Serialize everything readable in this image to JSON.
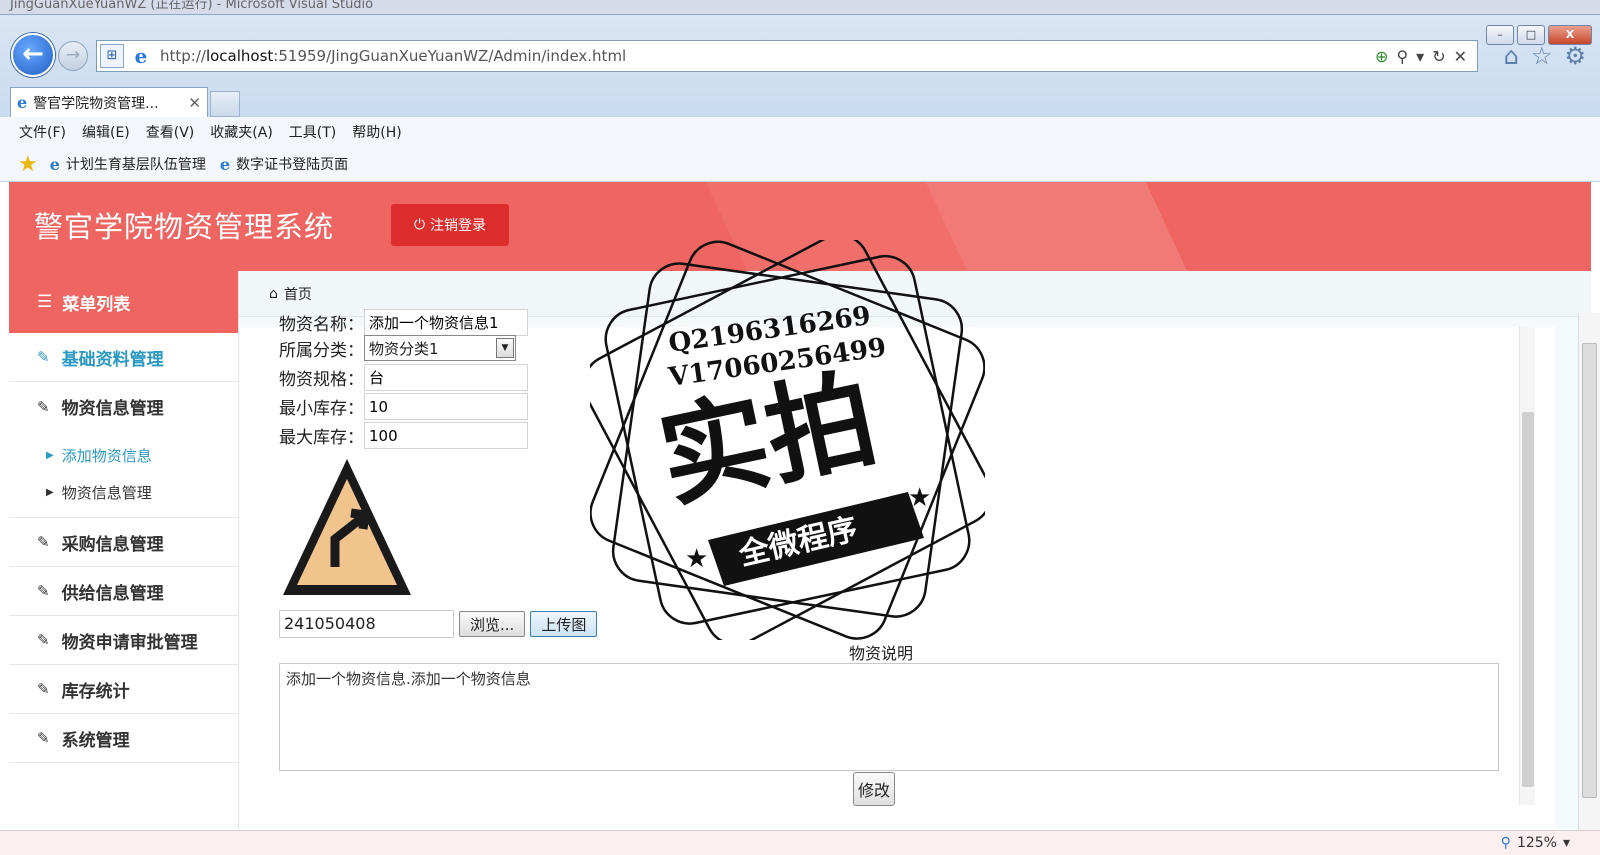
{
  "window": {
    "caption": "JingGuanXueYuanWZ (正在运行) - Microsoft Visual Studio",
    "min": "–",
    "max": "□",
    "close": "X"
  },
  "browser": {
    "url_host": "localhost",
    "url_prefix": "http://",
    "url_suffix": ":51959/JingGuanXueYuanWZ/Admin/index.html",
    "tab_title": "警官学院物资管理...",
    "menu": [
      "文件(F)",
      "编辑(E)",
      "查看(V)",
      "收藏夹(A)",
      "工具(T)",
      "帮助(H)"
    ],
    "favorites": [
      "计划生育基层队伍管理",
      "数字证书登陆页面"
    ],
    "zoom": "125%"
  },
  "header": {
    "title": "警官学院物资管理系统",
    "logout_label": "注销登录"
  },
  "sidebar": {
    "heading": "菜单列表",
    "items": [
      "基础资料管理",
      "物资信息管理",
      "采购信息管理",
      "供给信息管理",
      "物资申请审批管理",
      "库存统计",
      "系统管理"
    ],
    "sub_items": [
      "添加物资信息",
      "物资信息管理"
    ]
  },
  "breadcrumb": {
    "home": "首页"
  },
  "form": {
    "name_label": "物资名称：",
    "name_value": "添加一个物资信息1",
    "category_label": "所属分类：",
    "category_value": "物资分类1",
    "spec_label": "物资规格：",
    "spec_value": "台",
    "min_label": "最小库存：",
    "min_value": "10",
    "max_label": "最大库存：",
    "max_value": "100",
    "file_value": "241050408",
    "browse_label": "浏览...",
    "upload_label": "上传图",
    "desc_label": "物资说明",
    "desc_value": "添加一个物资信息.添加一个物资信息",
    "submit_label": "修改"
  },
  "watermark": {
    "qq": "Q2196316269",
    "vx": "V17060256499",
    "big": "实拍",
    "ribbon": "全微程序"
  },
  "colors": {
    "brand_red": "#ee6561",
    "logout_red": "#dd2d2d",
    "active_blue": "#2b9ac2"
  }
}
